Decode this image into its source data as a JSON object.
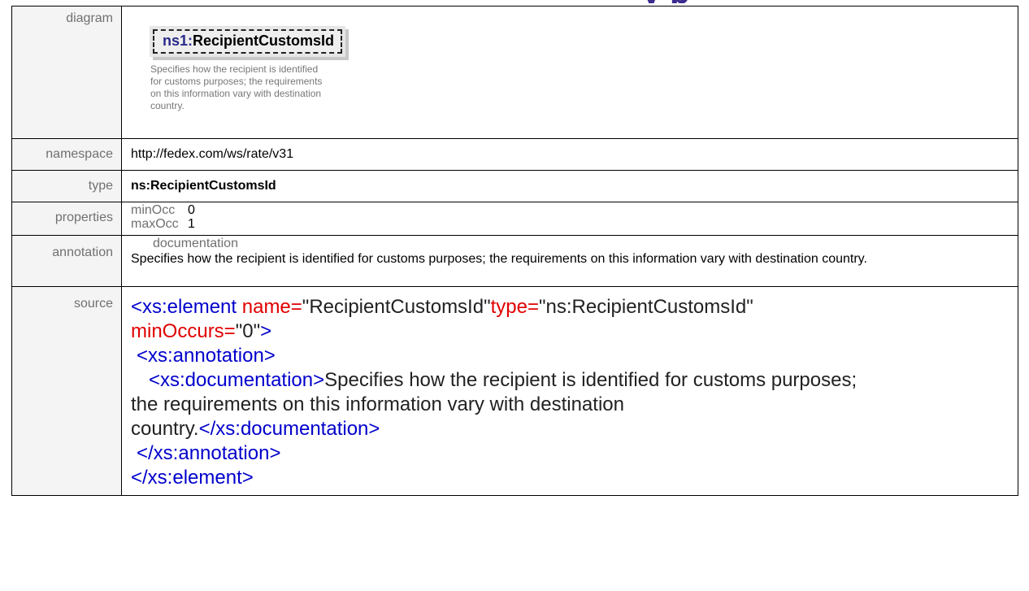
{
  "top_fragment": "y  p",
  "rows": {
    "diagram": {
      "label": "diagram",
      "element_prefix": "ns1:",
      "element_name": "RecipientCustomsId",
      "documentation": "Specifies how the recipient is identified for customs purposes; the requirements on this information vary with destination country."
    },
    "namespace": {
      "label": "namespace",
      "value": "http://fedex.com/ws/rate/v31"
    },
    "type": {
      "label": "type",
      "value": "ns:RecipientCustomsId"
    },
    "properties": {
      "label": "properties",
      "items": [
        {
          "key": "minOcc",
          "value": "0"
        },
        {
          "key": "maxOcc",
          "value": "1"
        }
      ]
    },
    "annotation": {
      "label": "annotation",
      "heading": "documentation",
      "text": "Specifies how the recipient is identified for customs purposes; the requirements on this information vary with destination country."
    },
    "source": {
      "label": "source",
      "open_tag": "<xs:element",
      "attr_name": " name=",
      "attr_name_val": "\"RecipientCustomsId\"",
      "attr_type": "type=",
      "attr_type_val": "\"ns:RecipientCustomsId\"",
      "attr_min": "minOccurs=",
      "attr_min_val": "\"0\"",
      "close_bracket": ">",
      "annotation_open": "<xs:annotation>",
      "documentation_open": "<xs:documentation>",
      "documentation_text_1": "Specifies how the recipient is identified for customs purposes;",
      "documentation_text_2": "the requirements on this information vary with destination",
      "documentation_text_3": "country.",
      "documentation_close": "</xs:documentation>",
      "annotation_close": "</xs:annotation>",
      "element_close": "</xs:element>"
    }
  }
}
